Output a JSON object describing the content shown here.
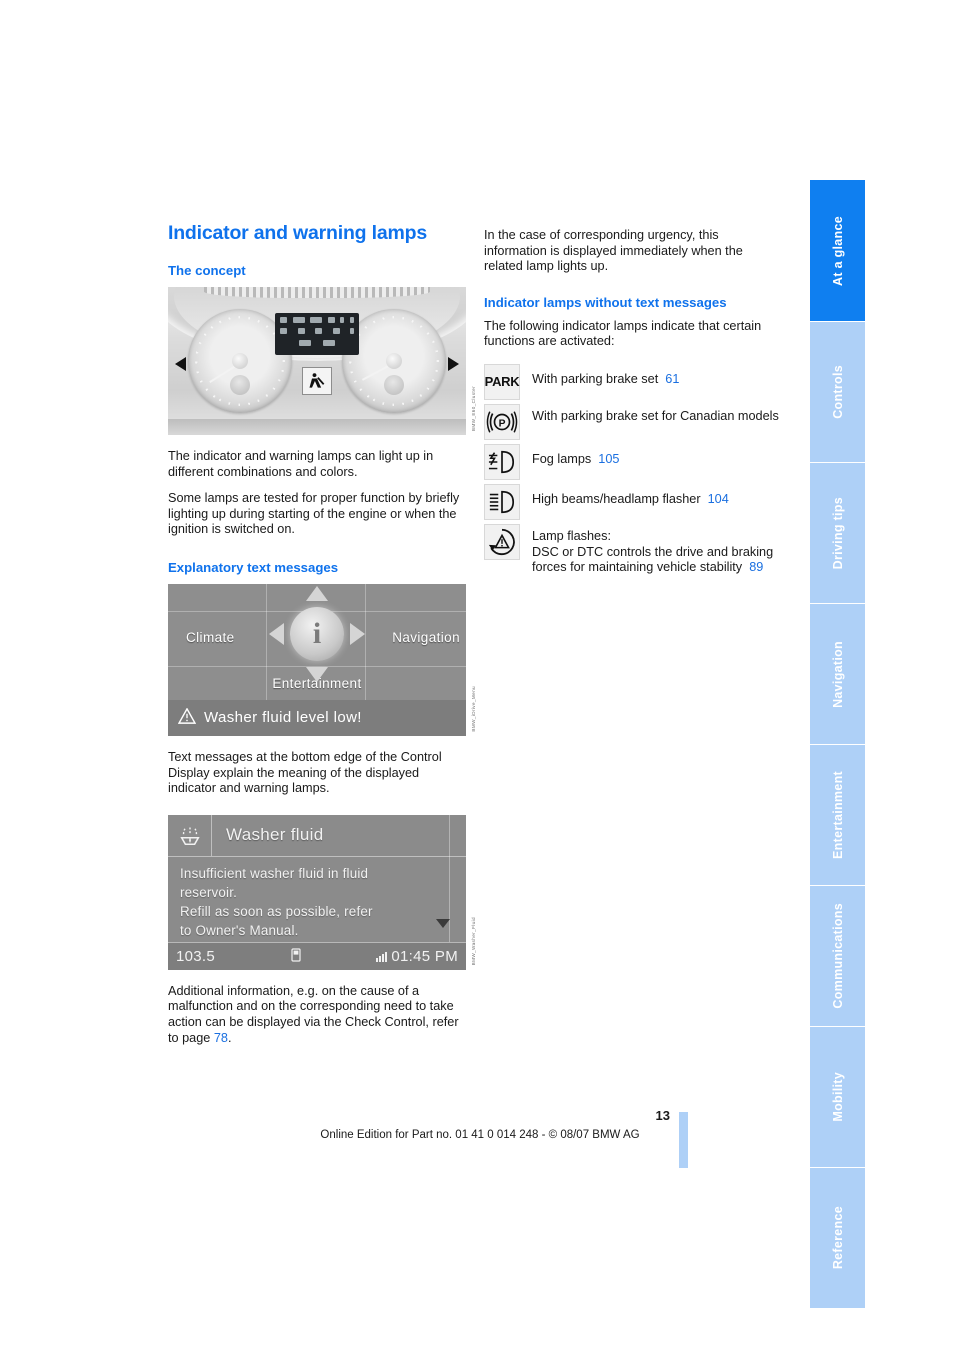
{
  "page": {
    "number": "13",
    "footer_text": "Online Edition for Part no. 01 41 0 014 248 - © 08/07 BMW AG",
    "accent_blue": "#0f72ec",
    "tab_active_blue": "#0f7ff0",
    "tab_inactive_blue": "#aed0f7"
  },
  "sidebar": {
    "tabs": [
      {
        "label": "At a glance",
        "active": true
      },
      {
        "label": "Controls",
        "active": false
      },
      {
        "label": "Driving tips",
        "active": false
      },
      {
        "label": "Navigation",
        "active": false
      },
      {
        "label": "Entertainment",
        "active": false
      },
      {
        "label": "Communications",
        "active": false
      },
      {
        "label": "Mobility",
        "active": false
      },
      {
        "label": "Reference",
        "active": false
      }
    ]
  },
  "left_column": {
    "title": "Indicator and warning lamps",
    "concept_heading": "The concept",
    "cluster_figure": {
      "credit": "BMW_E60_Cluster",
      "alt_name": "instrument-cluster-photo"
    },
    "paragraphs": [
      "The indicator and warning lamps can light up in different combinations and colors.",
      "Some lamps are tested for proper function by briefly lighting up during starting of the engine or when the ignition is switched on."
    ],
    "explanatory_heading": "Explanatory text messages",
    "idrive_figure": {
      "credit": "BMW_iDrive_Menu",
      "menu_items": {
        "climate": "Climate",
        "navigation": "Navigation",
        "entertainment": "Entertainment",
        "center_icon": "info-icon"
      },
      "status_message": "Washer fluid level low!"
    },
    "after_idrive_paragraph": "Text messages at the bottom edge of the Control Display explain the meaning of the displayed indicator and warning lamps.",
    "washer_figure": {
      "credit": "BMW_Washer_Fluid",
      "title": "Washer fluid",
      "title_icon": "washer-fluid-icon",
      "message_lines": [
        "Insufficient washer fluid in fluid",
        "reservoir.",
        "Refill as soon as possible, refer",
        "to Owner's Manual."
      ],
      "radio_station": "103.5",
      "clock": "01:45 PM",
      "signal_icon": "signal-bars-icon",
      "phone_icon": "phone-icon",
      "scroll_icon": "scroll-down-arrow-icon"
    },
    "closing_paragraph_pre": "Additional information, e.g. on the cause of a malfunction and on the corresponding need to take action can be displayed via the Check Control, refer to page ",
    "closing_paragraph_ref": "78",
    "closing_paragraph_post": "."
  },
  "right_column": {
    "intro_paragraph": "In the case of corresponding urgency, this information is displayed immediately when the related lamp lights up.",
    "lamps_heading": "Indicator lamps without text messages",
    "lamps_intro": "The following indicator lamps indicate that certain functions are activated:",
    "lamps": [
      {
        "icon": "park-brake-text-icon",
        "icon_label": "PARK",
        "text": "With parking brake set",
        "page_ref": "61"
      },
      {
        "icon": "park-brake-canadian-icon",
        "icon_label": "",
        "text": "With parking brake set for Canadian models",
        "page_ref": ""
      },
      {
        "icon": "fog-lamp-icon",
        "icon_label": "",
        "text": "Fog lamps",
        "page_ref": "105"
      },
      {
        "icon": "high-beam-icon",
        "icon_label": "",
        "text": "High beams/headlamp flasher",
        "page_ref": "104"
      },
      {
        "icon": "dsc-dtc-icon",
        "icon_label": "",
        "text": "Lamp flashes:\nDSC or DTC controls the drive and braking forces for maintaining vehicle stability",
        "page_ref": "89"
      }
    ]
  }
}
